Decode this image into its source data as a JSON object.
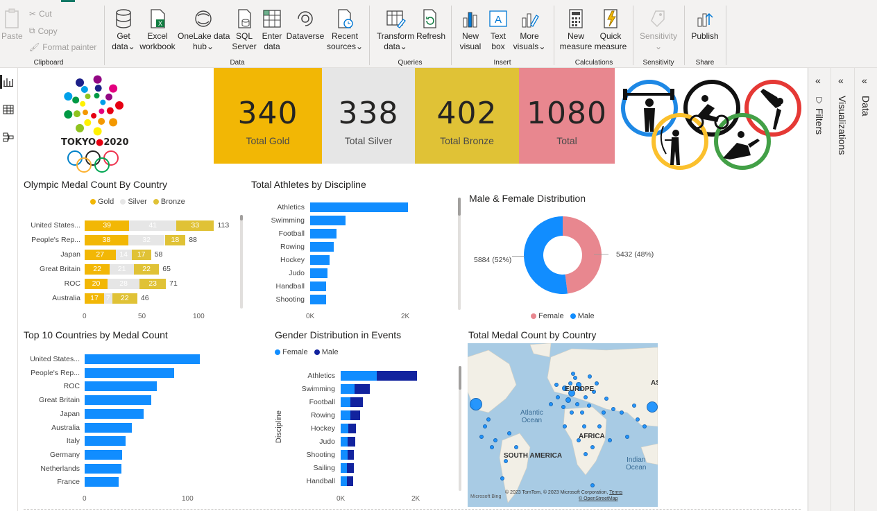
{
  "ribbon": {
    "clipboard": {
      "paste": "Paste",
      "cut": "Cut",
      "copy": "Copy",
      "format_painter": "Format painter",
      "group": "Clipboard"
    },
    "data": {
      "get_data_1": "Get",
      "get_data_2": "data",
      "excel_1": "Excel",
      "excel_2": "workbook",
      "onelake_1": "OneLake data",
      "onelake_2": "hub",
      "sql_1": "SQL",
      "sql_2": "Server",
      "enter_1": "Enter",
      "enter_2": "data",
      "dataverse": "Dataverse",
      "recent_1": "Recent",
      "recent_2": "sources",
      "group": "Data"
    },
    "queries": {
      "transform_1": "Transform",
      "transform_2": "data",
      "refresh": "Refresh",
      "group": "Queries"
    },
    "insert": {
      "newvisual_1": "New",
      "newvisual_2": "visual",
      "textbox_1": "Text",
      "textbox_2": "box",
      "more_1": "More",
      "more_2": "visuals",
      "group": "Insert"
    },
    "calculations": {
      "newmeasure_1": "New",
      "newmeasure_2": "measure",
      "quick_1": "Quick",
      "quick_2": "measure",
      "group": "Calculations"
    },
    "sensitivity": {
      "label": "Sensitivity",
      "group": "Sensitivity"
    },
    "share": {
      "publish": "Publish",
      "group": "Share"
    }
  },
  "panes": {
    "filters": "Filters",
    "visualizations": "Visualizations",
    "data": "Data"
  },
  "logo": {
    "text_left": "TOKYO",
    "text_right": "2020"
  },
  "kpis": [
    {
      "value": "340",
      "label": "Total Gold",
      "color": "#F2B705"
    },
    {
      "value": "338",
      "label": "Total Silver",
      "color": "#E6E6E6"
    },
    {
      "value": "402",
      "label": "Total Bronze",
      "color": "#E0C236"
    },
    {
      "value": "1080",
      "label": "Total",
      "color": "#E8878F"
    }
  ],
  "medal_chart": {
    "title": "Olympic Medal Count By Country",
    "legend": [
      "Gold",
      "Silver",
      "Bronze"
    ],
    "colors": [
      "#F2B705",
      "#E6E6E6",
      "#E0C236"
    ],
    "ticks": [
      "0",
      "50",
      "100"
    ],
    "max": 100,
    "rows": [
      {
        "label": "United States...",
        "gold": 39,
        "silver": 41,
        "bronze": 33,
        "total": "113"
      },
      {
        "label": "People's Rep...",
        "gold": 38,
        "silver": 32,
        "bronze": 18,
        "total": "88"
      },
      {
        "label": "Japan",
        "gold": 27,
        "silver": 14,
        "bronze": 17,
        "total": "58"
      },
      {
        "label": "Great Britain",
        "gold": 22,
        "silver": 21,
        "bronze": 22,
        "total": "65"
      },
      {
        "label": "ROC",
        "gold": 20,
        "silver": 28,
        "bronze": 23,
        "total": "71"
      },
      {
        "label": "Australia",
        "gold": 17,
        "silver": 7,
        "bronze": 22,
        "total": "46"
      }
    ]
  },
  "athletes_chart": {
    "title": "Total Athletes by Discipline",
    "ticks": [
      "0K",
      "2K"
    ],
    "max": 2000,
    "color": "#118DFF",
    "rows": [
      {
        "label": "Athletics",
        "value": 2060
      },
      {
        "label": "Swimming",
        "value": 740
      },
      {
        "label": "Football",
        "value": 560
      },
      {
        "label": "Rowing",
        "value": 500
      },
      {
        "label": "Hockey",
        "value": 410
      },
      {
        "label": "Judo",
        "value": 370
      },
      {
        "label": "Handball",
        "value": 340
      },
      {
        "label": "Shooting",
        "value": 340
      }
    ]
  },
  "gender_donut": {
    "title": "Male & Female Distribution",
    "female_label": "5432 (48%)",
    "male_label": "5884 (52%)",
    "female": 5432,
    "male": 5884,
    "legend": [
      "Female",
      "Male"
    ],
    "colors": {
      "female": "#E8878F",
      "male": "#118DFF"
    }
  },
  "top10_chart": {
    "title": "Top 10 Countries by Medal Count",
    "ticks": [
      "0",
      "100"
    ],
    "max": 100,
    "color": "#118DFF",
    "rows": [
      {
        "label": "United States...",
        "value": 113
      },
      {
        "label": "People's Rep...",
        "value": 88
      },
      {
        "label": "ROC",
        "value": 71
      },
      {
        "label": "Great Britain",
        "value": 65
      },
      {
        "label": "Japan",
        "value": 58
      },
      {
        "label": "Australia",
        "value": 46
      },
      {
        "label": "Italy",
        "value": 40
      },
      {
        "label": "Germany",
        "value": 37
      },
      {
        "label": "Netherlands",
        "value": 36
      },
      {
        "label": "France",
        "value": 33
      }
    ]
  },
  "events_chart": {
    "title": "Gender Distribution in Events",
    "legend": [
      "Female",
      "Male"
    ],
    "colors": [
      "#118DFF",
      "#12239E"
    ],
    "axis_title": "Discipline",
    "ticks": [
      "0K",
      "2K"
    ],
    "max": 2000,
    "rows": [
      {
        "label": "Athletics",
        "female": 970,
        "male": 1070
      },
      {
        "label": "Swimming",
        "female": 370,
        "male": 400
      },
      {
        "label": "Football",
        "female": 260,
        "male": 330
      },
      {
        "label": "Rowing",
        "female": 250,
        "male": 260
      },
      {
        "label": "Hockey",
        "female": 200,
        "male": 200
      },
      {
        "label": "Judo",
        "female": 190,
        "male": 200
      },
      {
        "label": "Shooting",
        "female": 180,
        "male": 180
      },
      {
        "label": "Sailing",
        "female": 170,
        "male": 180
      },
      {
        "label": "Handball",
        "female": 170,
        "male": 170
      }
    ]
  },
  "map": {
    "title": "Total Medal Count by Country",
    "labels": {
      "europe": "EUROPE",
      "atlantic_1": "Atlantic",
      "atlantic_2": "Ocean",
      "africa": "AFRICA",
      "south_america": "SOUTH AMERICA",
      "indian_1": "Indian",
      "indian_2": "Ocean",
      "asia": "AS"
    },
    "credit": "© 2023 TomTom, © 2023 Microsoft Corporation,",
    "terms": "Terms",
    "osm": "© OpenStreetMap",
    "bing": "Microsoft Bing"
  }
}
